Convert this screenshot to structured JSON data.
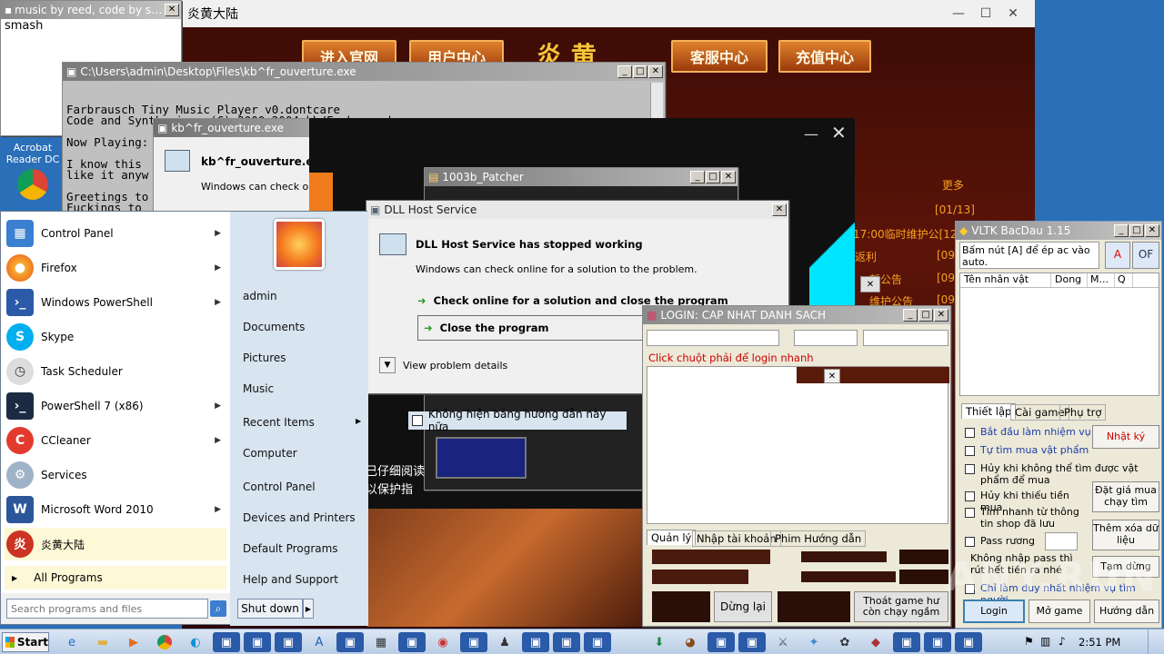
{
  "desktop": {
    "acrobat_label": "Acrobat Reader DC"
  },
  "music_window": {
    "title": "music by reed, code by sm...",
    "text": "music by reed, code by smash"
  },
  "game": {
    "title": "炎黄大陆",
    "buttons": [
      "进入官网",
      "用户中心",
      "客服中心",
      "充值中心"
    ],
    "more": "更多",
    "news": [
      "[01/13]",
      "17:00临时维护公[12,",
      "返利",
      "[09,",
      "新公告",
      "[09,",
      "维护公告",
      "[09,"
    ],
    "ticker1": "己仔细阅读",
    "ticker2": "以保护指"
  },
  "console": {
    "title": "C:\\Users\\admin\\Desktop\\Files\\kb^fr_ouverture.exe",
    "lines": [
      "Farbrausch Tiny Music Player v0.dontcare",
      "Code and Synthesizer (C) 2000-2004 kb/Farbrausch",
      "",
      "Now Playing:",
      "",
      "I know this",
      "like it anyw",
      "",
      "Greetings to",
      "Fuckings to"
    ]
  },
  "kbfr_dialog": {
    "title": "kb^fr_ouverture.exe",
    "heading": "kb^fr_ouverture.exe",
    "body": "Windows can check onlin"
  },
  "patcher": {
    "title": "1003b_Patcher",
    "checkbox": "Không hiện bảng hướng dẫn này nữa"
  },
  "dll_dialog": {
    "title": "DLL Host Service",
    "heading": "DLL Host Service has stopped working",
    "body": "Windows can check online for a solution to the problem.",
    "option1": "Check online for a solution and close the program",
    "option2": "Close the program",
    "details": "View problem details"
  },
  "login_window": {
    "title": "LOGIN: CAP NHAT DANH SACH",
    "hint": "Click chuột phải để login nhanh",
    "tabs": [
      "Quản lý",
      "Nhập tài khoản",
      "Phim Hướng dẫn"
    ],
    "btn_stop": "Dừng lại",
    "btn_exit": "Thoát game hư còn chạy ngầm"
  },
  "vltk": {
    "title": "VLTK BacDau 1.15",
    "notice": "Bấm nút [A] để ép ac vào auto.",
    "btn_a": "A",
    "btn_of": "OF",
    "columns": [
      "Tên nhân vật",
      "Dong",
      "M...",
      "Q"
    ],
    "tabs": [
      "Thiết lập",
      "Cài game",
      "Phụ trợ"
    ],
    "checks": [
      "Bắt đầu làm nhiệm vụ",
      "Tự tìm mua vật phẩm",
      "Hủy khi không thể tìm được vật phẩm để mua",
      "Hủy khi thiếu tiền mua",
      "Tìm nhanh từ thông tin shop đã lưu",
      "Pass rương"
    ],
    "note": "Không nhập pass thì rút hết tiền ra nhé",
    "check_last": "Chỉ làm duy nhất nhiệm vụ tìm người",
    "side_buttons": [
      "Nhật ký",
      "Đặt giá mua chạy tìm",
      "Thêm xóa dữ liệu",
      "Tạm dừng"
    ],
    "bottom_buttons": [
      "Login",
      "Mở game",
      "Hướng dẫn"
    ]
  },
  "start_menu": {
    "programs": [
      "Control Panel",
      "Firefox",
      "Windows PowerShell",
      "Skype",
      "Task Scheduler",
      "PowerShell 7 (x86)",
      "CCleaner",
      "Services",
      "Microsoft Word 2010",
      "炎黄大陆"
    ],
    "all_programs": "All Programs",
    "search_placeholder": "Search programs and files",
    "right": [
      "admin",
      "Documents",
      "Pictures",
      "Music",
      "Recent Items",
      "Computer",
      "Control Panel",
      "Devices and Printers",
      "Default Programs",
      "Help and Support"
    ],
    "shutdown": "Shut down"
  },
  "taskbar": {
    "start": "Start",
    "time": "2:51 PM"
  },
  "watermark": "ANY.RUN"
}
